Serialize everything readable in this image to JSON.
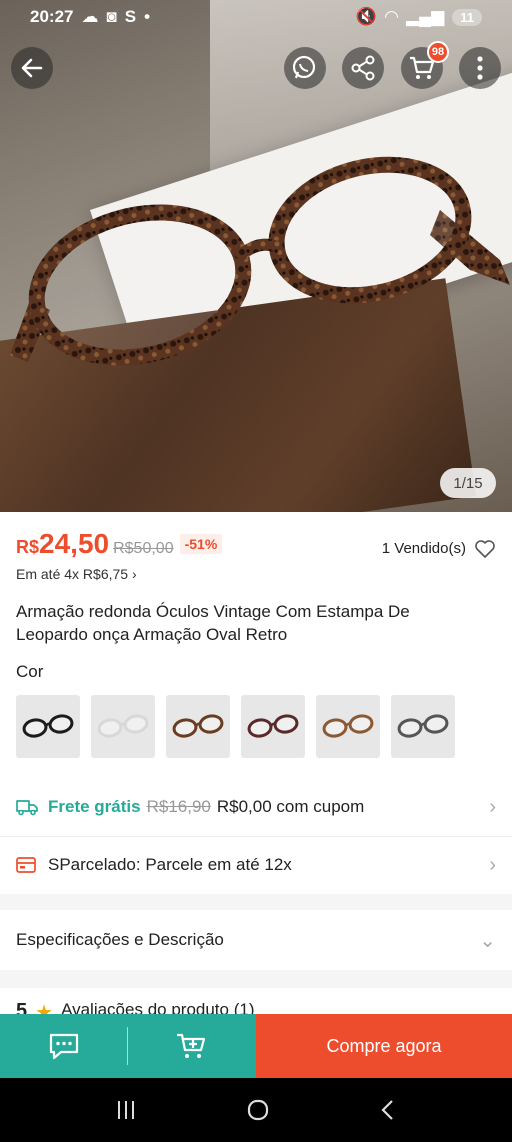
{
  "status_bar": {
    "time": "20:27",
    "battery": "11"
  },
  "hero": {
    "image_counter": "1/15",
    "cart_count": "98"
  },
  "price": {
    "currency": "R$",
    "current": "24,50",
    "original": "R$50,00",
    "discount": "-51%",
    "sold": "1 Vendido(s)",
    "installments": "Em até 4x R$6,75 ›"
  },
  "product": {
    "title": "Armação redonda Óculos Vintage Com Estampa De Leopardo onça Armação Oval Retro"
  },
  "color": {
    "label": "Cor",
    "options": [
      {
        "name": "preto",
        "frame": "#1c1c1c"
      },
      {
        "name": "transparente",
        "frame": "#d8d8d8"
      },
      {
        "name": "leopardo",
        "frame": "#6a3d22"
      },
      {
        "name": "vinho",
        "frame": "#5a2a2a"
      },
      {
        "name": "marrom",
        "frame": "#8a5a35"
      },
      {
        "name": "cinza",
        "frame": "#555555"
      }
    ]
  },
  "shipping": {
    "label": "Frete grátis",
    "old_price": "R$16,90",
    "new_text": "R$0,00 com cupom"
  },
  "installment_row": {
    "label": "SParcelado: Parcele em até 12x"
  },
  "specs": {
    "label": "Especificações e Descrição"
  },
  "rating_peek": {
    "score": "5",
    "label": "Avaliações do produto (1)"
  },
  "bottom_bar": {
    "buy_label": "Compre agora"
  },
  "colors": {
    "accent": "#ee4d2d",
    "teal": "#26aa99"
  }
}
